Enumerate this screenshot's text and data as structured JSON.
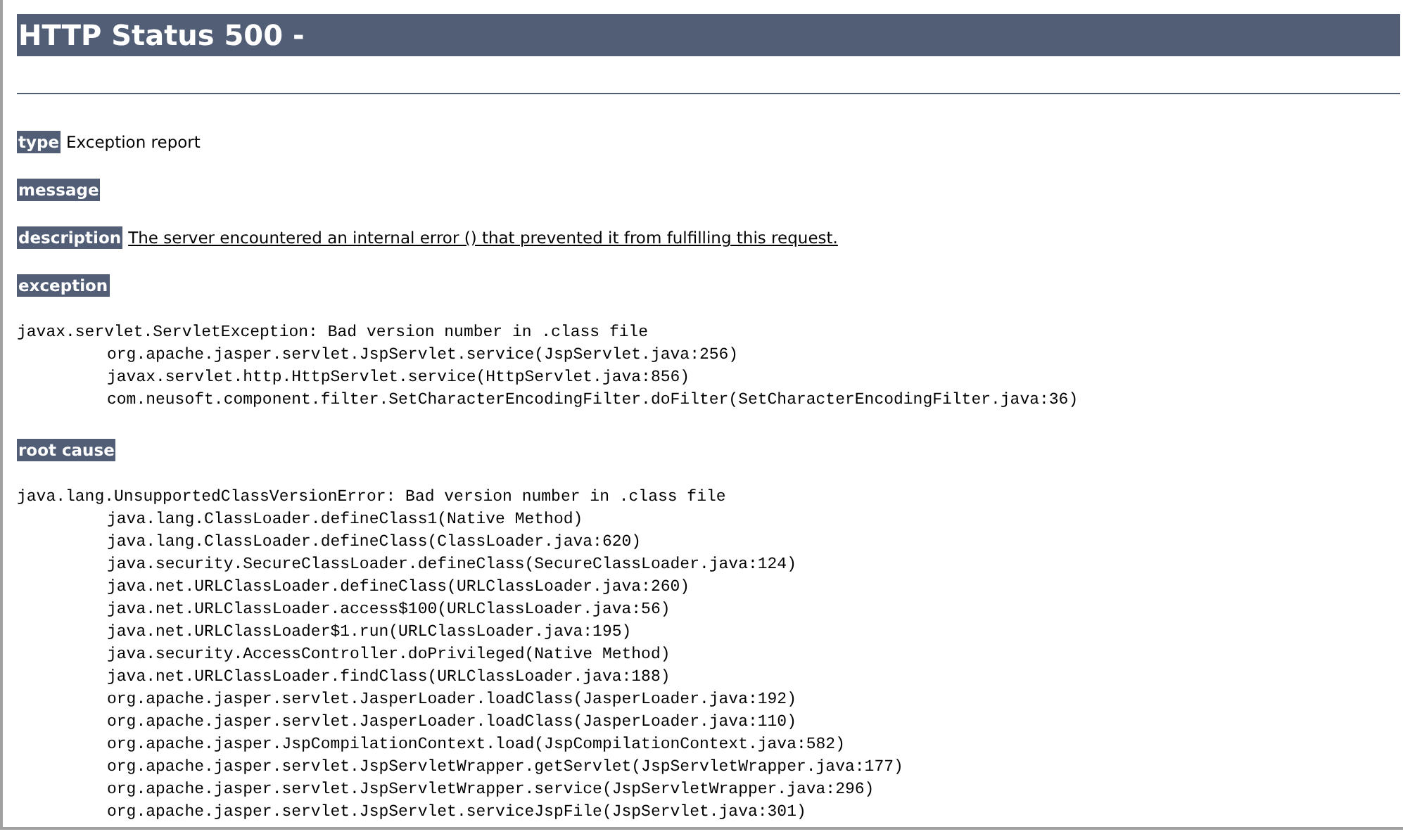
{
  "title": "HTTP Status 500 -",
  "sections": [
    {
      "label": "type",
      "kind": "text",
      "text": "Exception report"
    },
    {
      "label": "message",
      "kind": "empty"
    },
    {
      "label": "description",
      "kind": "link",
      "text": "The server encountered an internal error () that prevented it from fulfilling this request."
    },
    {
      "label": "exception",
      "kind": "trace",
      "head": "javax.servlet.ServletException: Bad version number in .class file",
      "frames": [
        "org.apache.jasper.servlet.JspServlet.service(JspServlet.java:256)",
        "javax.servlet.http.HttpServlet.service(HttpServlet.java:856)",
        "com.neusoft.component.filter.SetCharacterEncodingFilter.doFilter(SetCharacterEncodingFilter.java:36)"
      ]
    },
    {
      "label": "root cause",
      "kind": "trace",
      "head": "java.lang.UnsupportedClassVersionError: Bad version number in .class file",
      "frames": [
        "java.lang.ClassLoader.defineClass1(Native Method)",
        "java.lang.ClassLoader.defineClass(ClassLoader.java:620)",
        "java.security.SecureClassLoader.defineClass(SecureClassLoader.java:124)",
        "java.net.URLClassLoader.defineClass(URLClassLoader.java:260)",
        "java.net.URLClassLoader.access$100(URLClassLoader.java:56)",
        "java.net.URLClassLoader$1.run(URLClassLoader.java:195)",
        "java.security.AccessController.doPrivileged(Native Method)",
        "java.net.URLClassLoader.findClass(URLClassLoader.java:188)",
        "org.apache.jasper.servlet.JasperLoader.loadClass(JasperLoader.java:192)",
        "org.apache.jasper.servlet.JasperLoader.loadClass(JasperLoader.java:110)",
        "org.apache.jasper.JspCompilationContext.load(JspCompilationContext.java:582)",
        "org.apache.jasper.servlet.JspServletWrapper.getServlet(JspServletWrapper.java:177)",
        "org.apache.jasper.servlet.JspServletWrapper.service(JspServletWrapper.java:296)",
        "org.apache.jasper.servlet.JspServlet.serviceJspFile(JspServlet.java:301)"
      ]
    }
  ]
}
